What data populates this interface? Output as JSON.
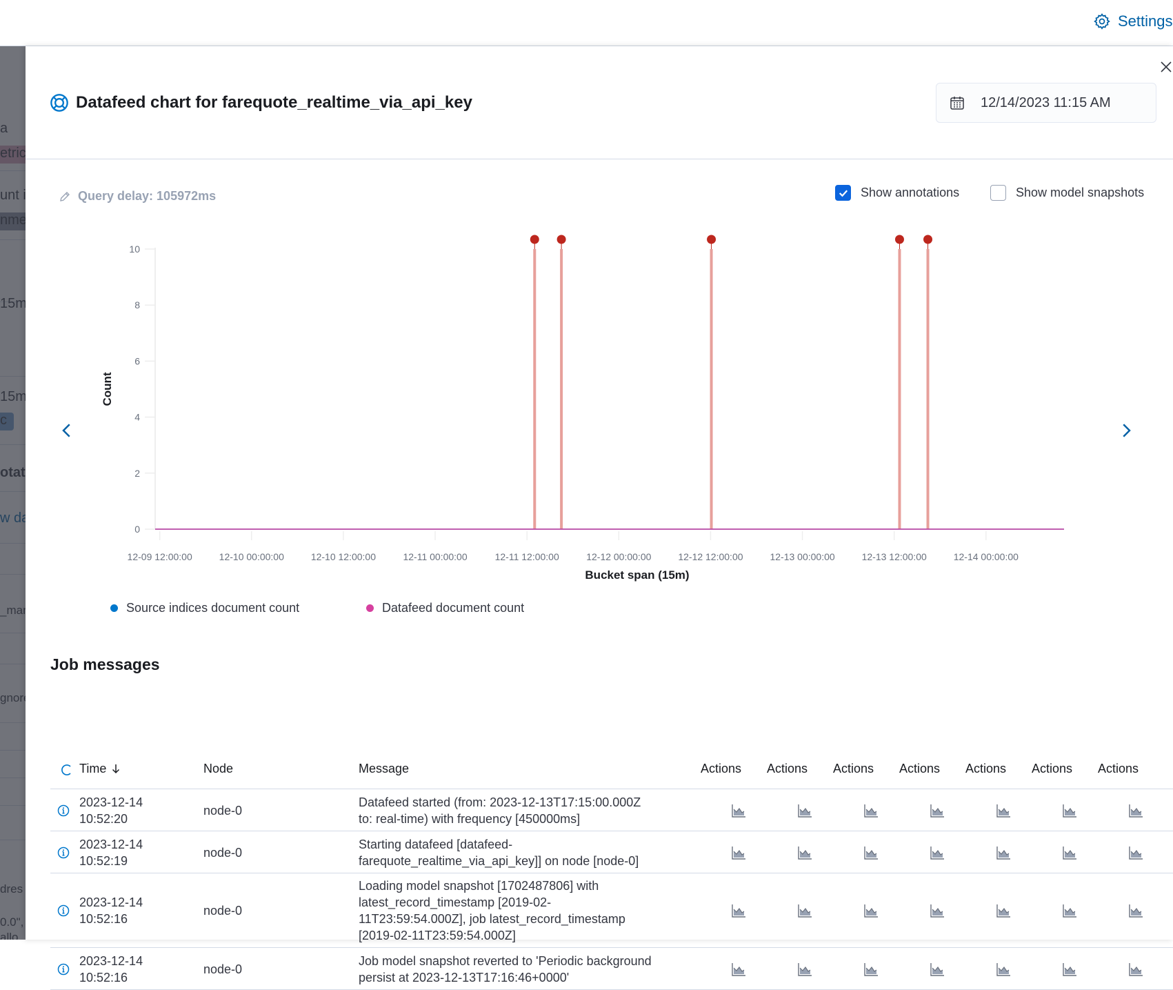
{
  "topbar": {
    "settings_label": "Settings"
  },
  "background_page": {
    "fragments": [
      "a",
      "etric",
      "unt i",
      "nmer",
      "15m",
      "15m",
      "c",
      "otati",
      "w da",
      "_man",
      "gnore",
      "dres",
      "0.0\",",
      "allo"
    ]
  },
  "flyout": {
    "title": "Datafeed chart for farequote_realtime_via_api_key",
    "date_value": "12/14/2023 11:15 AM",
    "query_delay": "Query delay: 105972ms",
    "show_annotations": {
      "label": "Show annotations",
      "checked": true
    },
    "show_model_snapshots": {
      "label": "Show model snapshots",
      "checked": false
    }
  },
  "chart_data": {
    "type": "line",
    "title": "",
    "xlabel": "Bucket span (15m)",
    "ylabel": "Count",
    "ylim": [
      0,
      10
    ],
    "yticks": [
      "0",
      "2",
      "4",
      "6",
      "8",
      "10"
    ],
    "xticks": [
      "12-09 12:00:00",
      "12-10 00:00:00",
      "12-10 12:00:00",
      "12-11 00:00:00",
      "12-11 12:00:00",
      "12-12 00:00:00",
      "12-12 12:00:00",
      "12-13 00:00:00",
      "12-13 12:00:00",
      "12-14 00:00:00"
    ],
    "x_range_hours": [
      -0.6,
      118.2
    ],
    "series": [
      {
        "name": "Source indices document count",
        "color": "#0077cc",
        "values_note": "0 across range",
        "values": [
          0,
          0
        ]
      },
      {
        "name": "Datafeed document count",
        "color": "#d6409f",
        "values": [
          0,
          0
        ]
      }
    ],
    "annotations": [
      {
        "x_hours_from_start": 49.0,
        "value": 10
      },
      {
        "x_hours_from_start": 52.5,
        "value": 10
      },
      {
        "x_hours_from_start": 72.1,
        "value": 10
      },
      {
        "x_hours_from_start": 96.7,
        "value": 10
      },
      {
        "x_hours_from_start": 100.4,
        "value": 10
      }
    ],
    "annotation_color": "#bd271e",
    "annotation_line_color": "#e7a09b",
    "legend": [
      "Source indices document count",
      "Datafeed document count"
    ],
    "legend_position": "bottom-left",
    "grid": false
  },
  "job_messages": {
    "title": "Job messages",
    "columns": [
      "Time",
      "Node",
      "Message",
      "Actions",
      "Actions",
      "Actions",
      "Actions",
      "Actions",
      "Actions",
      "Actions"
    ],
    "rows": [
      {
        "date": "2023-12-14",
        "time": "10:52:20",
        "node": "node-0",
        "message": [
          "Datafeed started (from: 2023-12-13T17:15:00.000Z",
          "to: real-time) with frequency [450000ms]"
        ]
      },
      {
        "date": "2023-12-14",
        "time": "10:52:19",
        "node": "node-0",
        "message": [
          "Starting datafeed [datafeed-",
          "farequote_realtime_via_api_key]] on node [node-0]"
        ]
      },
      {
        "date": "2023-12-14",
        "time": "10:52:16",
        "node": "node-0",
        "message": [
          "Loading model snapshot [1702487806] with",
          "latest_record_timestamp [2019-02-",
          "11T23:59:54.000Z], job latest_record_timestamp",
          "[2019-02-11T23:59:54.000Z]"
        ]
      },
      {
        "date": "2023-12-14",
        "time": "10:52:16",
        "node": "node-0",
        "message": [
          "Job model snapshot reverted to 'Periodic background",
          "persist at 2023-12-13T17:16:46+0000'"
        ]
      }
    ]
  }
}
